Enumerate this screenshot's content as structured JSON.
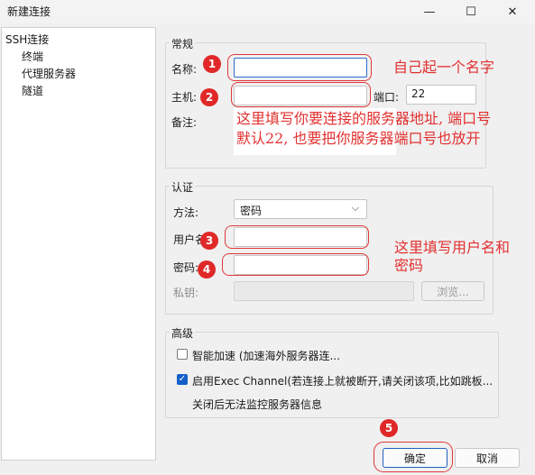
{
  "window": {
    "title": "新建连接",
    "minimize": "—",
    "maximize": "☐",
    "close": "✕"
  },
  "tree": {
    "items": [
      "SSH连接",
      "终端",
      "代理服务器",
      "隧道"
    ]
  },
  "general": {
    "title": "常规",
    "name_label": "名称:",
    "name_value": "",
    "host_label": "主机:",
    "host_value": "",
    "port_label": "端口:",
    "port_value": "22",
    "note_label": "备注:"
  },
  "auth": {
    "title": "认证",
    "method_label": "方法:",
    "method_value": "密码",
    "username_label": "用户名",
    "password_label": "密码:",
    "key_label": "私钥:",
    "browse_label": "浏览..."
  },
  "advanced": {
    "title": "高级",
    "smart_accel_label": "智能加速 (加速海外服务器连...",
    "smart_accel_checked": false,
    "exec_channel_label": "启用Exec Channel(若连接上就被断开,请关闭该项,比如跳板...",
    "exec_channel_checked": true,
    "exec_channel_note": "关闭后无法监控服务器信息"
  },
  "buttons": {
    "ok": "确定",
    "cancel": "取消"
  },
  "annotations": {
    "badges": [
      "1",
      "2",
      "3",
      "4",
      "5"
    ],
    "name_hint": "自己起一个名字",
    "host_hint_line1": "这里填写你要连接的服务器地址, 端口号",
    "host_hint_line2": "默认22, 也要把你服务器端口号也放开",
    "user_hint_line1": "这里填写用户名和",
    "user_hint_line2": "密码",
    "color": "#e23030"
  }
}
